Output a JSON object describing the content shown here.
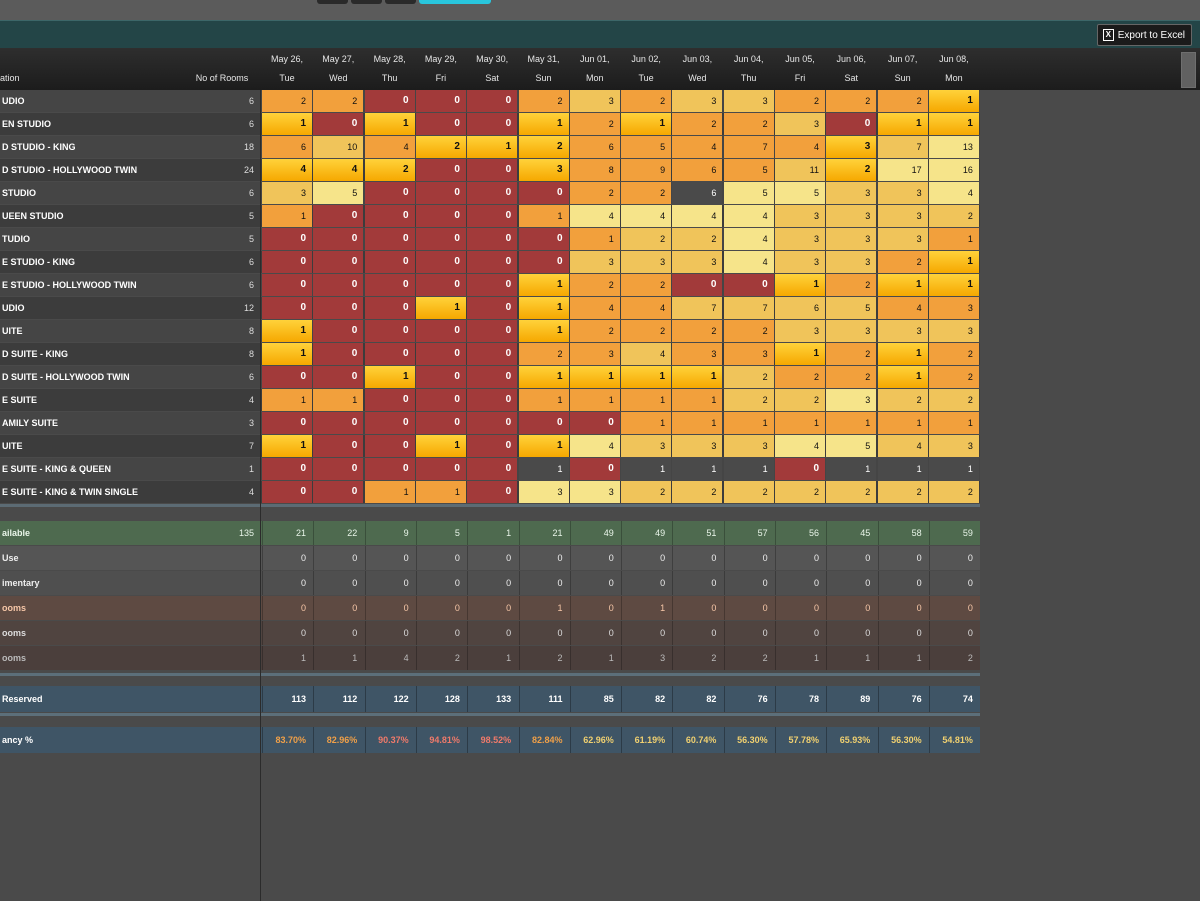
{
  "toolbar": {
    "export_label": "Export to Excel",
    "export_icon": "excel-icon"
  },
  "header": {
    "name_col": "ation",
    "rooms_col": "No of Rooms",
    "dates": [
      "May 26,",
      "May 27,",
      "May 28,",
      "May 29,",
      "May 30,",
      "May 31,",
      "Jun 01,",
      "Jun 02,",
      "Jun 03,",
      "Jun 04,",
      "Jun 05,",
      "Jun 06,",
      "Jun 07,",
      "Jun 08,"
    ],
    "days": [
      "Tue",
      "Wed",
      "Thu",
      "Fri",
      "Sat",
      "Sun",
      "Mon",
      "Tue",
      "Wed",
      "Thu",
      "Fri",
      "Sat",
      "Sun",
      "Mon"
    ]
  },
  "colors": {
    "red": "#a23a3a",
    "orange": "#f2a03c",
    "gold": "#ffc21a",
    "tan": "#f0c45a",
    "pale": "#f6e48a",
    "dark": "#4a4a4a"
  },
  "rows": [
    {
      "name": "UDIO",
      "rooms": "6",
      "vals": [
        "2",
        "2",
        "0",
        "0",
        "0",
        "2",
        "3",
        "2",
        "3",
        "3",
        "2",
        "2",
        "2",
        "1"
      ],
      "cls": [
        "o",
        "o",
        "r",
        "r",
        "r",
        "o",
        "t",
        "o",
        "t",
        "t",
        "o",
        "o",
        "o",
        "g"
      ]
    },
    {
      "name": "EN STUDIO",
      "rooms": "6",
      "vals": [
        "1",
        "0",
        "1",
        "0",
        "0",
        "1",
        "2",
        "1",
        "2",
        "2",
        "3",
        "0",
        "1",
        "1"
      ],
      "cls": [
        "g",
        "r",
        "g",
        "r",
        "r",
        "g",
        "o",
        "g",
        "o",
        "o",
        "t",
        "r",
        "g",
        "g"
      ]
    },
    {
      "name": "D STUDIO - KING",
      "rooms": "18",
      "vals": [
        "6",
        "10",
        "4",
        "2",
        "1",
        "2",
        "6",
        "5",
        "4",
        "7",
        "4",
        "3",
        "7",
        "13"
      ],
      "cls": [
        "o",
        "t",
        "o",
        "g",
        "g",
        "g",
        "o",
        "o",
        "o",
        "o",
        "o",
        "g",
        "t",
        "p"
      ]
    },
    {
      "name": "D STUDIO - HOLLYWOOD TWIN",
      "rooms": "24",
      "vals": [
        "4",
        "4",
        "2",
        "0",
        "0",
        "3",
        "8",
        "9",
        "6",
        "5",
        "11",
        "2",
        "17",
        "16"
      ],
      "cls": [
        "g",
        "g",
        "g",
        "r",
        "r",
        "g",
        "o",
        "o",
        "o",
        "o",
        "t",
        "g",
        "p",
        "p"
      ]
    },
    {
      "name": " STUDIO",
      "rooms": "6",
      "vals": [
        "3",
        "5",
        "0",
        "0",
        "0",
        "0",
        "2",
        "2",
        "6",
        "5",
        "5",
        "3",
        "3",
        "4"
      ],
      "cls": [
        "t",
        "p",
        "r",
        "r",
        "r",
        "r",
        "o",
        "o",
        "d",
        "p",
        "p",
        "t",
        "t",
        "p"
      ]
    },
    {
      "name": "UEEN STUDIO",
      "rooms": "5",
      "vals": [
        "1",
        "0",
        "0",
        "0",
        "0",
        "1",
        "4",
        "4",
        "4",
        "4",
        "3",
        "3",
        "3",
        "2"
      ],
      "cls": [
        "o",
        "r",
        "r",
        "r",
        "r",
        "o",
        "p",
        "p",
        "p",
        "p",
        "t",
        "t",
        "t",
        "t"
      ]
    },
    {
      "name": "TUDIO",
      "rooms": "5",
      "vals": [
        "0",
        "0",
        "0",
        "0",
        "0",
        "0",
        "1",
        "2",
        "2",
        "4",
        "3",
        "3",
        "3",
        "1"
      ],
      "cls": [
        "r",
        "r",
        "r",
        "r",
        "r",
        "r",
        "o",
        "t",
        "t",
        "p",
        "t",
        "t",
        "t",
        "o"
      ]
    },
    {
      "name": "E STUDIO - KING",
      "rooms": "6",
      "vals": [
        "0",
        "0",
        "0",
        "0",
        "0",
        "0",
        "3",
        "3",
        "3",
        "4",
        "3",
        "3",
        "2",
        "1"
      ],
      "cls": [
        "r",
        "r",
        "r",
        "r",
        "r",
        "r",
        "t",
        "t",
        "t",
        "p",
        "t",
        "t",
        "o",
        "g"
      ]
    },
    {
      "name": "E STUDIO - HOLLYWOOD TWIN",
      "rooms": "6",
      "vals": [
        "0",
        "0",
        "0",
        "0",
        "0",
        "1",
        "2",
        "2",
        "0",
        "0",
        "1",
        "2",
        "1",
        "1"
      ],
      "cls": [
        "r",
        "r",
        "r",
        "r",
        "r",
        "g",
        "o",
        "o",
        "r",
        "r",
        "g",
        "o",
        "g",
        "g"
      ]
    },
    {
      "name": "UDIO",
      "rooms": "12",
      "vals": [
        "0",
        "0",
        "0",
        "1",
        "0",
        "1",
        "4",
        "4",
        "7",
        "7",
        "6",
        "5",
        "4",
        "3"
      ],
      "cls": [
        "r",
        "r",
        "r",
        "g",
        "r",
        "g",
        "o",
        "o",
        "t",
        "t",
        "t",
        "t",
        "o",
        "o"
      ]
    },
    {
      "name": "UITE",
      "rooms": "8",
      "vals": [
        "1",
        "0",
        "0",
        "0",
        "0",
        "1",
        "2",
        "2",
        "2",
        "2",
        "3",
        "3",
        "3",
        "3"
      ],
      "cls": [
        "g",
        "r",
        "r",
        "r",
        "r",
        "g",
        "o",
        "o",
        "o",
        "o",
        "t",
        "t",
        "t",
        "t"
      ]
    },
    {
      "name": "D SUITE - KING",
      "rooms": "8",
      "vals": [
        "1",
        "0",
        "0",
        "0",
        "0",
        "2",
        "3",
        "4",
        "3",
        "3",
        "1",
        "2",
        "1",
        "2"
      ],
      "cls": [
        "g",
        "r",
        "r",
        "r",
        "r",
        "o",
        "o",
        "t",
        "o",
        "o",
        "g",
        "o",
        "g",
        "o"
      ]
    },
    {
      "name": "D SUITE - HOLLYWOOD TWIN",
      "rooms": "6",
      "vals": [
        "0",
        "0",
        "1",
        "0",
        "0",
        "1",
        "1",
        "1",
        "1",
        "2",
        "2",
        "2",
        "1",
        "2"
      ],
      "cls": [
        "r",
        "r",
        "g",
        "r",
        "r",
        "g",
        "g",
        "g",
        "g",
        "t",
        "o",
        "o",
        "g",
        "o"
      ]
    },
    {
      "name": "E SUITE",
      "rooms": "4",
      "vals": [
        "1",
        "1",
        "0",
        "0",
        "0",
        "1",
        "1",
        "1",
        "1",
        "2",
        "2",
        "3",
        "2",
        "2"
      ],
      "cls": [
        "o",
        "o",
        "r",
        "r",
        "r",
        "o",
        "o",
        "o",
        "o",
        "t",
        "t",
        "p",
        "t",
        "t"
      ]
    },
    {
      "name": "AMILY SUITE",
      "rooms": "3",
      "vals": [
        "0",
        "0",
        "0",
        "0",
        "0",
        "0",
        "0",
        "1",
        "1",
        "1",
        "1",
        "1",
        "1",
        "1"
      ],
      "cls": [
        "r",
        "r",
        "r",
        "r",
        "r",
        "r",
        "r",
        "o",
        "o",
        "o",
        "o",
        "o",
        "o",
        "o"
      ]
    },
    {
      "name": "UITE",
      "rooms": "7",
      "vals": [
        "1",
        "0",
        "0",
        "1",
        "0",
        "1",
        "4",
        "3",
        "3",
        "3",
        "4",
        "5",
        "4",
        "3"
      ],
      "cls": [
        "g",
        "r",
        "r",
        "g",
        "r",
        "g",
        "p",
        "t",
        "t",
        "t",
        "p",
        "p",
        "t",
        "t"
      ]
    },
    {
      "name": "E SUITE - KING & QUEEN",
      "rooms": "1",
      "vals": [
        "0",
        "0",
        "0",
        "0",
        "0",
        "1",
        "0",
        "1",
        "1",
        "1",
        "0",
        "1",
        "1",
        "1"
      ],
      "cls": [
        "r",
        "r",
        "r",
        "r",
        "r",
        "d",
        "r",
        "d",
        "d",
        "d",
        "r",
        "d",
        "d",
        "d"
      ]
    },
    {
      "name": "E SUITE - KING & TWIN SINGLE",
      "rooms": "4",
      "vals": [
        "0",
        "0",
        "1",
        "1",
        "0",
        "3",
        "3",
        "2",
        "2",
        "2",
        "2",
        "2",
        "2",
        "2"
      ],
      "cls": [
        "r",
        "r",
        "o",
        "o",
        "r",
        "p",
        "p",
        "t",
        "t",
        "t",
        "t",
        "t",
        "t",
        "t"
      ]
    }
  ],
  "summary": [
    {
      "name": "ailable",
      "rooms": "135",
      "vals": [
        "21",
        "22",
        "9",
        "5",
        "1",
        "21",
        "49",
        "49",
        "51",
        "57",
        "56",
        "45",
        "58",
        "59"
      ],
      "bg": "#4e6a4f",
      "fg": "#e9f5e9"
    },
    {
      "name": " Use",
      "rooms": "",
      "vals": [
        "0",
        "0",
        "0",
        "0",
        "0",
        "0",
        "0",
        "0",
        "0",
        "0",
        "0",
        "0",
        "0",
        "0"
      ],
      "bg": "#555555",
      "fg": "#eeeeee"
    },
    {
      "name": "imentary",
      "rooms": "",
      "vals": [
        "0",
        "0",
        "0",
        "0",
        "0",
        "0",
        "0",
        "0",
        "0",
        "0",
        "0",
        "0",
        "0",
        "0"
      ],
      "bg": "#4f4f4f",
      "fg": "#eeeeee"
    },
    {
      "name": "ooms",
      "rooms": "",
      "vals": [
        "0",
        "0",
        "0",
        "0",
        "0",
        "1",
        "0",
        "1",
        "0",
        "0",
        "0",
        "0",
        "0",
        "0"
      ],
      "bg": "#5e4a42",
      "fg": "#f7c7a8"
    },
    {
      "name": "ooms",
      "rooms": "",
      "vals": [
        "0",
        "0",
        "0",
        "0",
        "0",
        "0",
        "0",
        "0",
        "0",
        "0",
        "0",
        "0",
        "0",
        "0"
      ],
      "bg": "#504440",
      "fg": "#dddddd"
    },
    {
      "name": "ooms",
      "rooms": "",
      "vals": [
        "1",
        "1",
        "4",
        "2",
        "1",
        "2",
        "1",
        "3",
        "2",
        "2",
        "1",
        "1",
        "1",
        "2"
      ],
      "bg": "#4b3f3c",
      "fg": "#bbbbbb"
    }
  ],
  "reserved": {
    "name": " Reserved",
    "vals": [
      "113",
      "112",
      "122",
      "128",
      "133",
      "111",
      "85",
      "82",
      "82",
      "76",
      "78",
      "89",
      "76",
      "74"
    ]
  },
  "occupancy": {
    "name": "ancy %",
    "vals": [
      "83.70%",
      "82.96%",
      "90.37%",
      "94.81%",
      "98.52%",
      "82.84%",
      "62.96%",
      "61.19%",
      "60.74%",
      "56.30%",
      "57.78%",
      "65.93%",
      "56.30%",
      "54.81%"
    ],
    "colors": [
      "#f0a048",
      "#f0a048",
      "#f07a6a",
      "#f07a6a",
      "#f07a6a",
      "#f0a048",
      "#f0d070",
      "#f0d070",
      "#f0d070",
      "#f0d070",
      "#f0d070",
      "#f0d070",
      "#f0d070",
      "#f0d070"
    ]
  }
}
